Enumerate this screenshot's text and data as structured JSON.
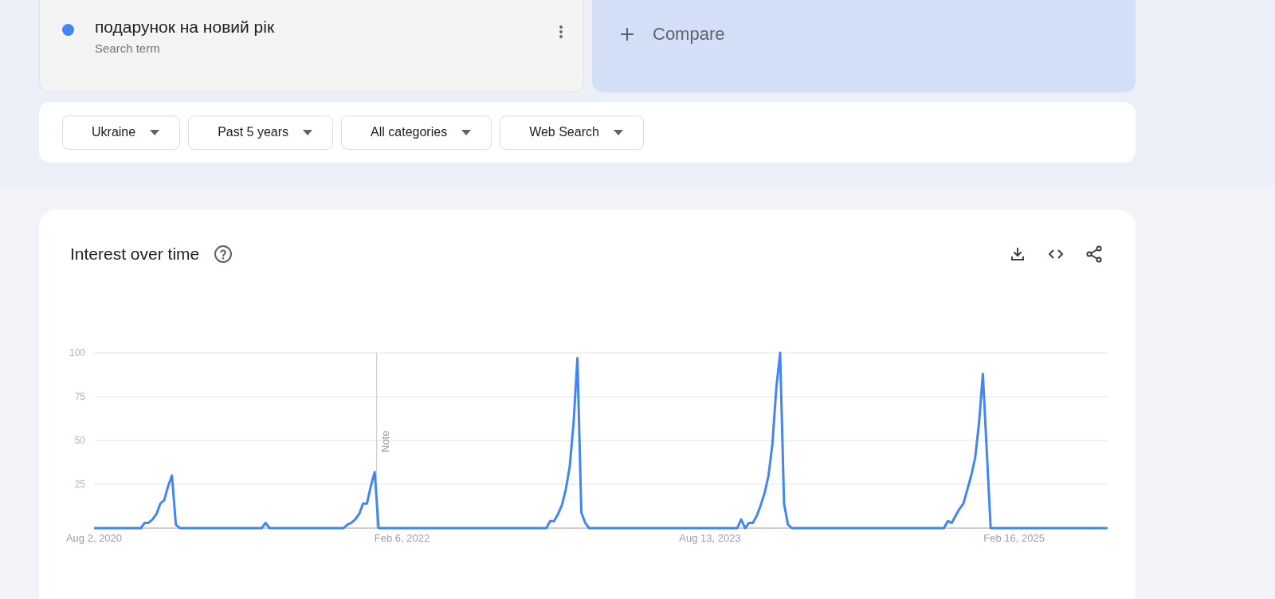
{
  "search_terms": [
    {
      "term": "подарунок на новий рік",
      "subtitle": "Search term",
      "color": "#4285f4"
    }
  ],
  "compare": {
    "label": "Compare"
  },
  "filters": [
    {
      "label": "Ukraine"
    },
    {
      "label": "Past 5 years"
    },
    {
      "label": "All categories"
    },
    {
      "label": "Web Search"
    }
  ],
  "interest_over_time": {
    "title": "Interest over time",
    "chart_data": {
      "type": "line",
      "grid": true,
      "ylim": [
        0,
        100
      ],
      "categories": [
        "Aug 2, 2020",
        null,
        null,
        null,
        null,
        null,
        null,
        null,
        null,
        null,
        null,
        null,
        null,
        null,
        null,
        null,
        null,
        null,
        null,
        null,
        null,
        null,
        null,
        null,
        null,
        null,
        null,
        null,
        null,
        null,
        null,
        null,
        null,
        null,
        null,
        null,
        null,
        null,
        null,
        null,
        null,
        null,
        null,
        null,
        null,
        null,
        null,
        null,
        null,
        null,
        null,
        null,
        null,
        null,
        null,
        null,
        null,
        null,
        null,
        null,
        null,
        null,
        null,
        null,
        null,
        null,
        null,
        null,
        null,
        null,
        null,
        null,
        null,
        null,
        null,
        null,
        null,
        null,
        null,
        "Feb 6, 2022",
        null,
        null,
        null,
        null,
        null,
        null,
        null,
        null,
        null,
        null,
        null,
        null,
        null,
        null,
        null,
        null,
        null,
        null,
        null,
        null,
        null,
        null,
        null,
        null,
        null,
        null,
        null,
        null,
        null,
        null,
        null,
        null,
        null,
        null,
        null,
        null,
        null,
        null,
        null,
        null,
        null,
        null,
        null,
        null,
        null,
        null,
        null,
        null,
        null,
        null,
        null,
        null,
        null,
        null,
        null,
        null,
        null,
        null,
        null,
        null,
        null,
        null,
        null,
        null,
        null,
        null,
        null,
        null,
        null,
        null,
        null,
        null,
        null,
        null,
        null,
        null,
        null,
        null,
        "Aug 13, 2023",
        null,
        null,
        null,
        null,
        null,
        null,
        null,
        null,
        null,
        null,
        null,
        null,
        null,
        null,
        null,
        null,
        null,
        null,
        null,
        null,
        null,
        null,
        null,
        null,
        null,
        null,
        null,
        null,
        null,
        null,
        null,
        null,
        null,
        null,
        null,
        null,
        null,
        null,
        null,
        null,
        null,
        null,
        null,
        null,
        null,
        null,
        null,
        null,
        null,
        null,
        null,
        null,
        null,
        null,
        null,
        null,
        null,
        null,
        null,
        null,
        null,
        null,
        null,
        null,
        null,
        null,
        null,
        null,
        null,
        null,
        null,
        null,
        null,
        null,
        null,
        null,
        null,
        "Feb 16, 2025",
        null,
        null,
        null,
        null,
        null,
        null,
        null,
        null,
        null,
        null,
        null,
        null,
        null,
        null,
        null,
        null,
        null,
        null,
        null,
        null,
        null,
        null,
        null,
        null
      ],
      "yticks": [
        25,
        50,
        75,
        100
      ],
      "annotations": [
        "Note"
      ],
      "series": [
        {
          "color": "#4285f4",
          "values": [
            0,
            0,
            0,
            0,
            0,
            0,
            0,
            0,
            0,
            0,
            0,
            0,
            0,
            3,
            3,
            5,
            8,
            14,
            16,
            24,
            30,
            2,
            0,
            0,
            0,
            0,
            0,
            0,
            0,
            0,
            0,
            0,
            0,
            0,
            0,
            0,
            0,
            0,
            0,
            0,
            0,
            0,
            0,
            0,
            3,
            0,
            0,
            0,
            0,
            0,
            0,
            0,
            0,
            0,
            0,
            0,
            0,
            0,
            0,
            0,
            0,
            0,
            0,
            0,
            0,
            2,
            3,
            5,
            8,
            14,
            14,
            24,
            32,
            0,
            0,
            0,
            0,
            0,
            0,
            0,
            0,
            0,
            0,
            0,
            0,
            0,
            0,
            0,
            0,
            0,
            0,
            0,
            0,
            0,
            0,
            0,
            0,
            0,
            0,
            0,
            0,
            0,
            0,
            0,
            0,
            0,
            0,
            0,
            0,
            0,
            0,
            0,
            0,
            0,
            0,
            0,
            0,
            4,
            4,
            8,
            13,
            22,
            35,
            60,
            97,
            9,
            3,
            0,
            0,
            0,
            0,
            0,
            0,
            0,
            0,
            0,
            0,
            0,
            0,
            0,
            0,
            0,
            0,
            0,
            0,
            0,
            0,
            0,
            0,
            0,
            0,
            0,
            0,
            0,
            0,
            0,
            0,
            0,
            0,
            0,
            0,
            0,
            0,
            0,
            0,
            0,
            5,
            0,
            3,
            3,
            7,
            13,
            20,
            30,
            48,
            80,
            100,
            14,
            2,
            0,
            0,
            0,
            0,
            0,
            0,
            0,
            0,
            0,
            0,
            0,
            0,
            0,
            0,
            0,
            0,
            0,
            0,
            0,
            0,
            0,
            0,
            0,
            0,
            0,
            0,
            0,
            0,
            0,
            0,
            0,
            0,
            0,
            0,
            0,
            0,
            0,
            0,
            0,
            0,
            4,
            3,
            7,
            11,
            14,
            22,
            30,
            40,
            60,
            88,
            44,
            0,
            0,
            0,
            0,
            0,
            0,
            0,
            0,
            0,
            0,
            0,
            0,
            0,
            0,
            0,
            0,
            0,
            0,
            0,
            0,
            0,
            0,
            0,
            0,
            0,
            0,
            0,
            0,
            0,
            0,
            0
          ]
        }
      ]
    }
  }
}
